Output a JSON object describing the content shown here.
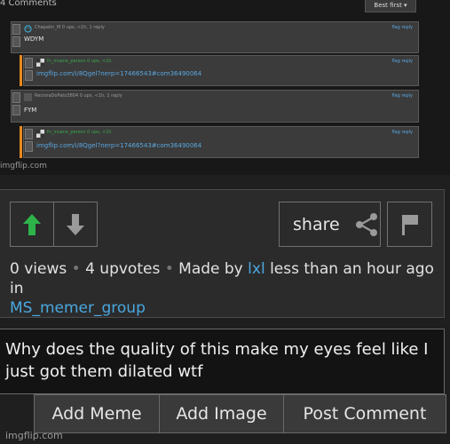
{
  "embedded_screenshot": {
    "title": "4 Comments",
    "sort_label": "Best first ▾",
    "brand": "imgflip.com",
    "comments": [
      {
        "user": "Chapatin_M  0 ups, <1h, 1 reply",
        "text": "WDYM",
        "reply": "flag  reply"
      },
      {
        "user": "fn_insane_person  0 ups, <1h",
        "text": "imgflip.com/i/8Qgel?nerp=17466543#com36490064",
        "reply": "flag  reply"
      },
      {
        "user": "RecioraDoPato3804  0 ups, <1h, 1 reply",
        "text": "FYM",
        "reply": "flag  reply"
      },
      {
        "user": "fn_insane_person  0 ups, <1h",
        "text": "imgflip.com/i/8Qgel?nerp=17466543#com36490064",
        "reply": "flag  reply"
      }
    ]
  },
  "actions": {
    "share_label": "share"
  },
  "stats": {
    "views": "0 views",
    "upvotes": "4 upvotes",
    "made_by_prefix": "Made by",
    "author": "lxl",
    "time_suffix": "less than an hour ago in",
    "stream": "MS_memer_group"
  },
  "composer": {
    "text": "Why does the quality of this make my eyes feel like I just got them dilated wtf",
    "buttons": {
      "add_meme": "Add Meme",
      "add_image": "Add Image",
      "post_comment": "Post Comment"
    }
  },
  "footer": {
    "brand": "imgflip.com"
  },
  "colors": {
    "upvote": "#2db34a",
    "link": "#4aa8e0",
    "reply_bar": "#e48a1e"
  }
}
